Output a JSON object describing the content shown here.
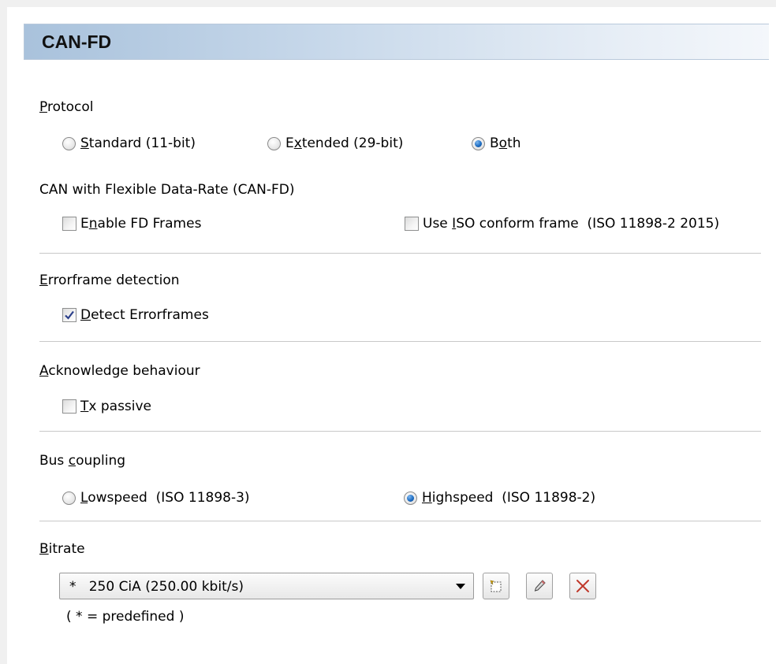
{
  "header": {
    "title": "CAN-FD"
  },
  "protocol": {
    "label": "Protocol",
    "options": [
      "Standard (11-bit)",
      "Extended (29-bit)",
      "Both"
    ],
    "selected": "Both"
  },
  "canfd": {
    "label": "CAN with Flexible Data-Rate (CAN-FD)",
    "enable_fd": {
      "label": "Enable FD Frames",
      "checked": false
    },
    "iso_conform": {
      "label": "Use ISO conform frame  (ISO 11898-2 2015)",
      "checked": false
    }
  },
  "errorframe": {
    "label": "Errorframe detection",
    "detect": {
      "label": "Detect Errorframes",
      "checked": true
    }
  },
  "acknowledge": {
    "label": "Acknowledge behaviour",
    "tx_passive": {
      "label": "Tx passive",
      "checked": false
    }
  },
  "bus_coupling": {
    "label": "Bus coupling",
    "options": [
      "Lowspeed  (ISO 11898-3)",
      "Highspeed  (ISO 11898-2)"
    ],
    "selected": "Highspeed  (ISO 11898-2)"
  },
  "bitrate": {
    "label": "Bitrate",
    "selected_value": "*   250 CiA (250.00 kbit/s)",
    "note": "( * = predefined )",
    "buttons": [
      "new-icon",
      "edit-pencil-icon",
      "delete-x-icon"
    ],
    "delete_color": "#c0392b"
  }
}
